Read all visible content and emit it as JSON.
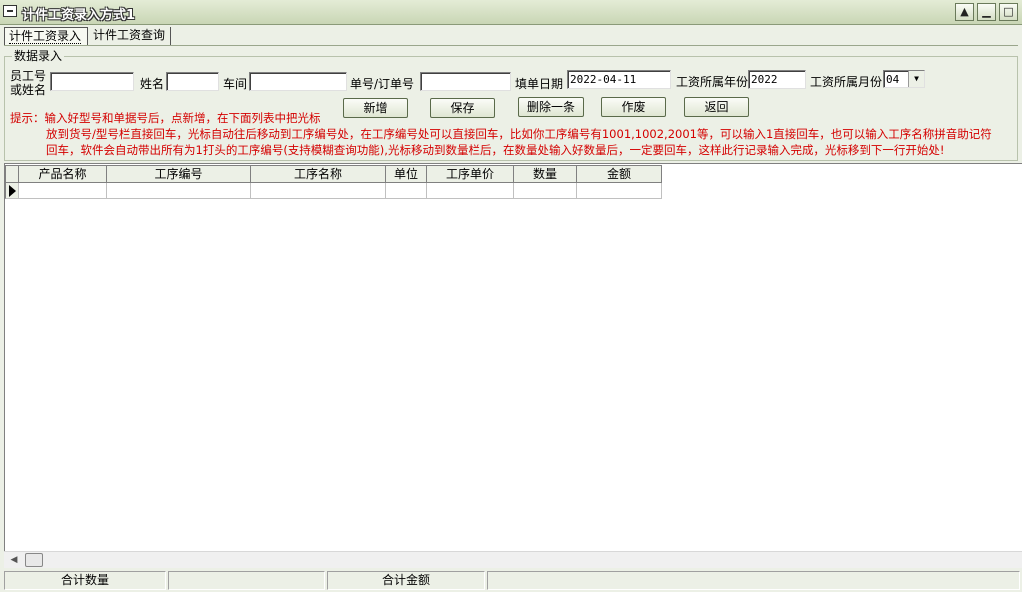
{
  "window": {
    "title": "计件工资录入方式1",
    "controls": [
      "minimize",
      "restore",
      "maximize"
    ]
  },
  "tabs": [
    {
      "label": "计件工资录入",
      "active": true
    },
    {
      "label": "计件工资查询",
      "active": false
    }
  ],
  "form": {
    "group_label": "数据录入",
    "employee_label_line1": "员工号",
    "employee_label_line2": "或姓名",
    "employee_value": "",
    "name_label": "姓名",
    "name_value": "",
    "workshop_label": "车间",
    "workshop_value": "",
    "order_label": "单号/订单号",
    "order_value": "",
    "date_label": "填单日期",
    "date_value": "2022-04-11",
    "year_label": "工资所属年份",
    "year_value": "2022",
    "month_label": "工资所属月份",
    "month_value": "04"
  },
  "buttons": {
    "add": "新增",
    "save": "保存",
    "delete": "删除一条",
    "void": "作废",
    "back": "返回"
  },
  "hint": {
    "line1": "提示：输入好型号和单据号后，点新增，在下面列表中把光标",
    "line2": "放到货号/型号栏直接回车，光标自动往后移动到工序编号处，在工序编号处可以直接回车，比如你工序编号有1001,1002,2001等，可以输入1直接回车，也可以输入工序名称拼音助记符",
    "line3": "回车，软件会自动带出所有为1打头的工序编号(支持模糊查询功能),光标移动到数量栏后，在数量处输入好数量后，一定要回车，这样此行记录输入完成，光标移到下一行开始处!"
  },
  "table": {
    "columns": [
      "产品名称",
      "工序编号",
      "工序名称",
      "单位",
      "工序单价",
      "数量",
      "金额"
    ],
    "rows": [
      [
        "",
        "",
        "",
        "",
        "",
        "",
        ""
      ]
    ]
  },
  "status": {
    "qty_label": "合计数量",
    "qty_value": "",
    "amount_label": "合计金额",
    "amount_value": ""
  },
  "colors": {
    "hint_text": "#d40000",
    "background": "#ecf0e6"
  }
}
